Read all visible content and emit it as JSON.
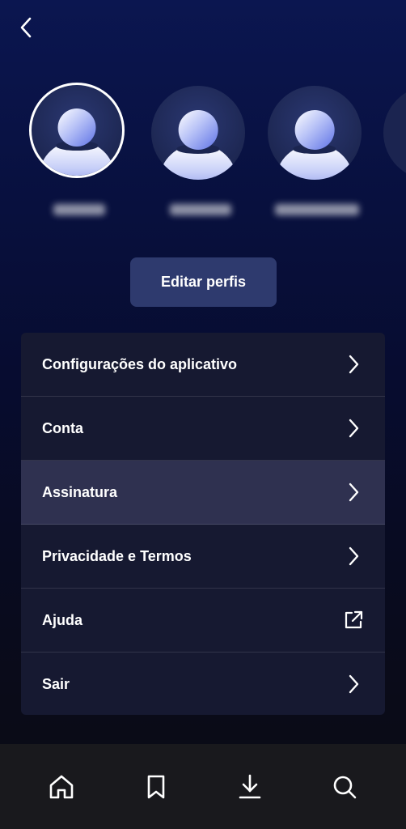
{
  "header": {
    "back_icon": "chevron-left-icon"
  },
  "profiles": [
    {
      "name": "",
      "selected": true
    },
    {
      "name": "",
      "selected": false
    },
    {
      "name": "",
      "selected": false
    },
    {
      "name": "",
      "selected": false
    }
  ],
  "edit_button": {
    "label": "Editar perfis"
  },
  "menu": {
    "items": [
      {
        "label": "Configurações do aplicativo",
        "icon": "chevron-right-icon"
      },
      {
        "label": "Conta",
        "icon": "chevron-right-icon"
      },
      {
        "label": "Assinatura",
        "icon": "chevron-right-icon"
      },
      {
        "label": "Privacidade e Termos",
        "icon": "chevron-right-icon"
      },
      {
        "label": "Ajuda",
        "icon": "external-link-icon"
      },
      {
        "label": "Sair",
        "icon": "chevron-right-icon"
      }
    ]
  },
  "bottom_nav": {
    "items": [
      {
        "icon": "home-icon"
      },
      {
        "icon": "bookmark-icon"
      },
      {
        "icon": "download-icon"
      },
      {
        "icon": "search-icon"
      }
    ]
  },
  "colors": {
    "background_top": "#0b1650",
    "background_bottom": "#0b0b14",
    "menu_background": "#161931",
    "menu_highlight": "#2f3150",
    "edit_button": "#2e3a6e",
    "nav_background": "#19191d"
  }
}
